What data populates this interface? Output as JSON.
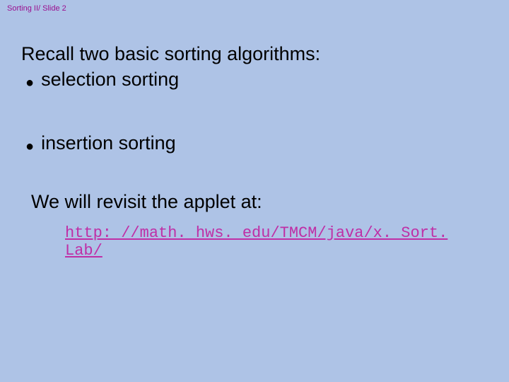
{
  "header": "Sorting II/ Slide 2",
  "intro": "Recall two basic sorting algorithms:",
  "bullets": [
    "selection sorting",
    "insertion sorting"
  ],
  "revisit": "We will revisit the applet at:",
  "link": "http: //math. hws. edu/TMCM/java/x. Sort. Lab/"
}
